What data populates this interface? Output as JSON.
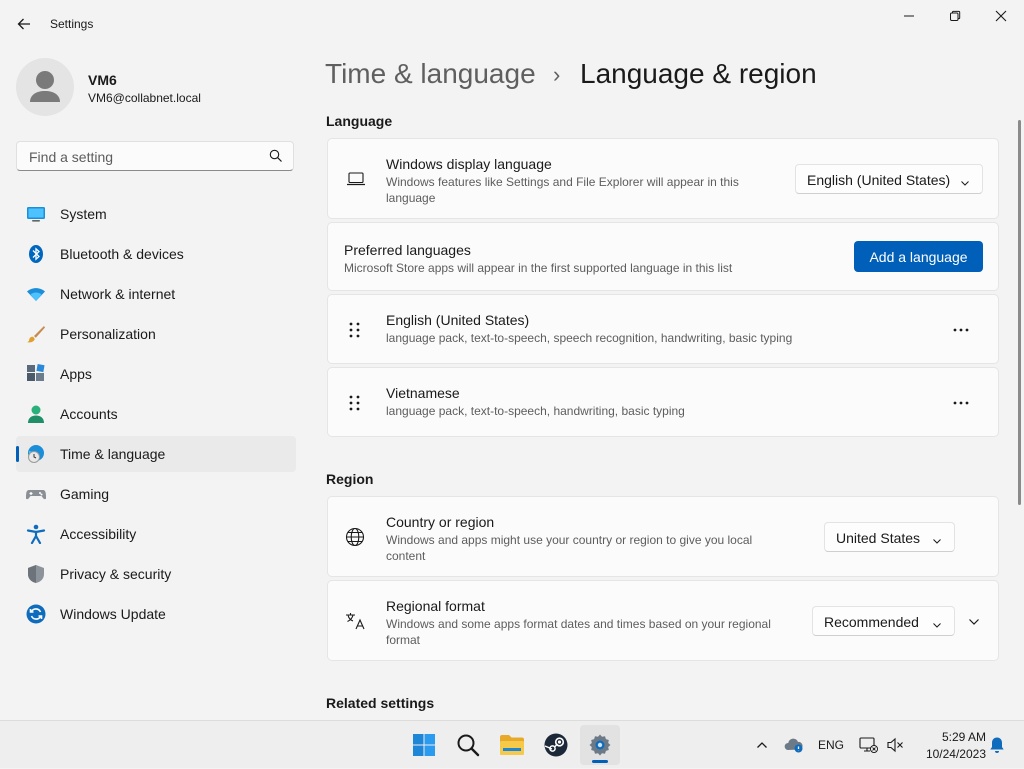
{
  "window": {
    "app_title": "Settings",
    "controls": [
      "minimize",
      "maximize",
      "close"
    ]
  },
  "profile": {
    "name": "VM6",
    "email": "VM6@collabnet.local"
  },
  "search": {
    "placeholder": "Find a setting"
  },
  "sidebar": {
    "items": [
      {
        "label": "System",
        "icon": "system-icon"
      },
      {
        "label": "Bluetooth & devices",
        "icon": "bluetooth-icon"
      },
      {
        "label": "Network & internet",
        "icon": "wifi-icon"
      },
      {
        "label": "Personalization",
        "icon": "paintbrush-icon"
      },
      {
        "label": "Apps",
        "icon": "apps-icon"
      },
      {
        "label": "Accounts",
        "icon": "accounts-icon"
      },
      {
        "label": "Time & language",
        "icon": "time-language-icon",
        "selected": true
      },
      {
        "label": "Gaming",
        "icon": "gaming-icon"
      },
      {
        "label": "Accessibility",
        "icon": "accessibility-icon"
      },
      {
        "label": "Privacy & security",
        "icon": "shield-icon"
      },
      {
        "label": "Windows Update",
        "icon": "windows-update-icon"
      }
    ]
  },
  "breadcrumb": {
    "parent": "Time & language",
    "separator": "›",
    "current": "Language & region"
  },
  "language_section": {
    "heading": "Language",
    "display_language": {
      "title": "Windows display language",
      "description": "Windows features like Settings and File Explorer will appear in this language",
      "value": "English (United States)"
    },
    "preferred": {
      "title": "Preferred languages",
      "description": "Microsoft Store apps will appear in the first supported language in this list",
      "button": "Add a language"
    },
    "languages": [
      {
        "name": "English (United States)",
        "features": "language pack, text-to-speech, speech recognition, handwriting, basic typing"
      },
      {
        "name": "Vietnamese",
        "features": "language pack, text-to-speech, handwriting, basic typing"
      }
    ]
  },
  "region_section": {
    "heading": "Region",
    "country": {
      "title": "Country or region",
      "description": "Windows and apps might use your country or region to give you local content",
      "value": "United States"
    },
    "format": {
      "title": "Regional format",
      "description": "Windows and some apps format dates and times based on your regional format",
      "value": "Recommended"
    }
  },
  "related": {
    "heading": "Related settings"
  },
  "taskbar": {
    "apps": [
      "start-icon",
      "search-icon",
      "file-explorer-icon",
      "steam-icon",
      "settings-icon"
    ],
    "active_app": "settings-icon",
    "language": "ENG",
    "time": "5:29 AM",
    "date": "10/24/2023"
  },
  "colors": {
    "accent": "#005fb8",
    "window_bg": "#f3f3f3",
    "card_bg": "#fbfbfb"
  }
}
